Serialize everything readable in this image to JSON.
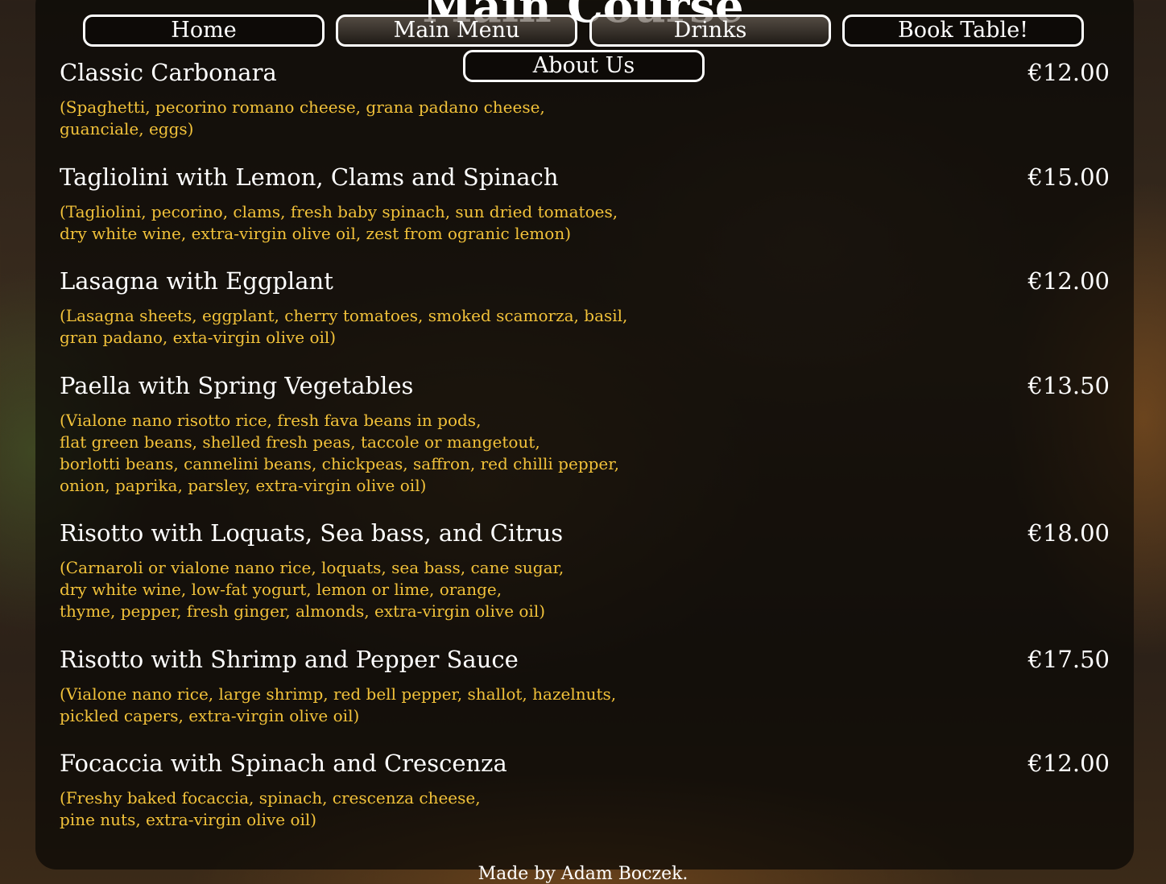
{
  "page": {
    "title": "Main Course"
  },
  "nav": {
    "items": [
      {
        "label": "Home"
      },
      {
        "label": "Main Menu"
      },
      {
        "label": "Drinks"
      },
      {
        "label": "Book Table!"
      },
      {
        "label": "About Us"
      }
    ]
  },
  "menu": {
    "items": [
      {
        "name": "Classic Carbonara",
        "price": "€12.00",
        "description": "(Spaghetti, pecorino romano cheese, grana padano cheese,\nguanciale, eggs)"
      },
      {
        "name": "Tagliolini with Lemon, Clams and Spinach",
        "price": "€15.00",
        "description": "(Tagliolini, pecorino, clams, fresh baby spinach, sun dried tomatoes,\ndry white wine, extra-virgin olive oil, zest from ogranic lemon)"
      },
      {
        "name": "Lasagna with Eggplant",
        "price": "€12.00",
        "description": "(Lasagna sheets, eggplant, cherry tomatoes, smoked scamorza, basil,\ngran padano, exta-virgin olive oil)"
      },
      {
        "name": "Paella with Spring Vegetables",
        "price": "€13.50",
        "description": "(Vialone nano risotto rice, fresh fava beans in pods,\nflat green beans, shelled fresh peas, taccole or mangetout,\nborlotti beans, cannelini beans, chickpeas, saffron, red chilli pepper,\nonion, paprika, parsley, extra-virgin olive oil)"
      },
      {
        "name": "Risotto with Loquats, Sea bass, and Citrus",
        "price": "€18.00",
        "description": "(Carnaroli or vialone nano rice, loquats, sea bass, cane sugar,\ndry white wine, low-fat yogurt, lemon or lime, orange,\nthyme, pepper, fresh ginger, almonds, extra-virgin olive oil)"
      },
      {
        "name": "Risotto with Shrimp and Pepper Sauce",
        "price": "€17.50",
        "description": "(Vialone nano rice, large shrimp, red bell pepper, shallot, hazelnuts,\npickled capers, extra-virgin olive oil)"
      },
      {
        "name": "Focaccia with Spinach and Crescenza",
        "price": "€12.00",
        "description": "(Freshy baked focaccia, spinach, crescenza cheese,\npine nuts, extra-virgin olive oil)"
      }
    ]
  },
  "footer": {
    "credit": "Made by Adam Boczek."
  }
}
